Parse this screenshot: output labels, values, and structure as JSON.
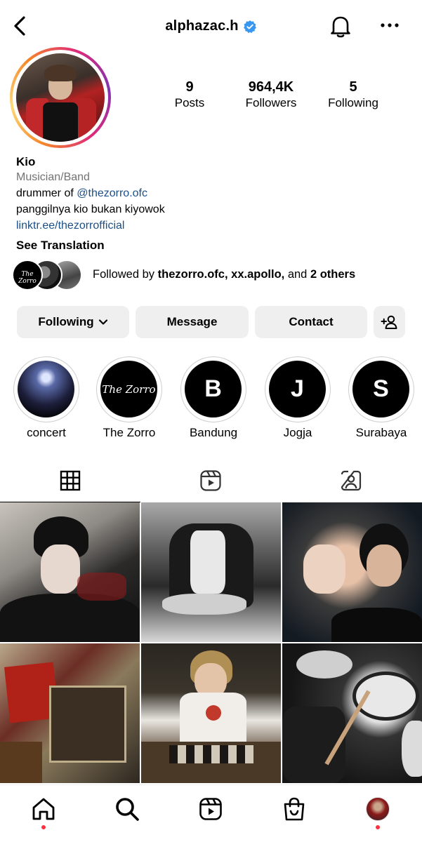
{
  "header": {
    "username": "alphazac.h",
    "verified": true
  },
  "icons": {
    "back": "chevron-left-icon",
    "verified": "verified-badge-icon",
    "bell": "bell-icon",
    "more": "more-icon"
  },
  "stats": [
    {
      "value": "9",
      "label": "Posts"
    },
    {
      "value": "964,4K",
      "label": "Followers"
    },
    {
      "value": "5",
      "label": "Following"
    }
  ],
  "bio": {
    "name": "Kio",
    "category": "Musician/Band",
    "line1_prefix": "drummer of ",
    "line1_mention": "@thezorro.ofc",
    "line2": "panggilnya kio bukan kiyowok",
    "link": "linktr.ee/thezorrofficial",
    "see_translation": "See Translation"
  },
  "followed_by": {
    "prefix": "Followed by ",
    "names": "thezorro.ofc, xx.apollo,",
    "middle": " and ",
    "others": "2 others",
    "avatar1_text": "The Zorro"
  },
  "actions": {
    "following": "Following",
    "message": "Message",
    "contact": "Contact"
  },
  "highlights": [
    {
      "label": "concert",
      "glyph": ""
    },
    {
      "label": "The Zorro",
      "glyph": "The Zorro"
    },
    {
      "label": "Bandung",
      "glyph": "B"
    },
    {
      "label": "Jogja",
      "glyph": "J"
    },
    {
      "label": "Surabaya",
      "glyph": "S"
    }
  ],
  "tabs": [
    {
      "name": "grid-icon",
      "active": true
    },
    {
      "name": "reels-icon",
      "active": false
    },
    {
      "name": "tagged-icon",
      "active": false
    }
  ],
  "bottom_nav": [
    "home-icon",
    "search-icon",
    "reels-icon",
    "shop-icon",
    "profile-avatar"
  ],
  "colors": {
    "link": "#1b4f8a",
    "button_bg": "#efefef",
    "notification_dot": "#ff3040",
    "verified": "#3897f0"
  }
}
